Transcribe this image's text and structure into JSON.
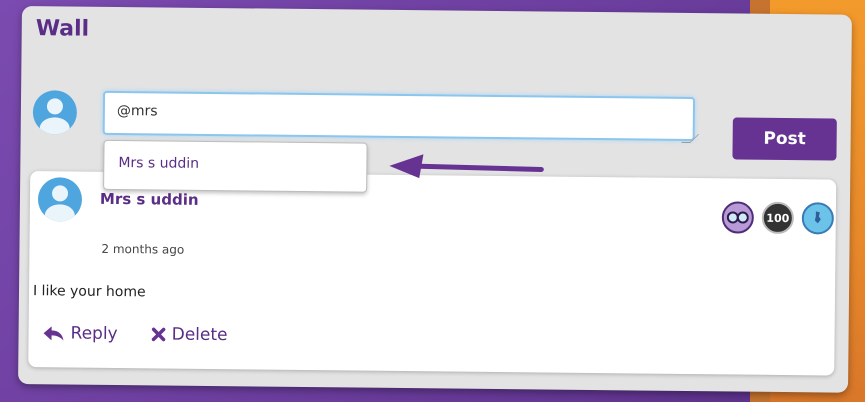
{
  "wall": {
    "title": "Wall"
  },
  "post": {
    "input_value": "@mrs",
    "post_label": "Post"
  },
  "mention_suggestions": [
    {
      "label": "Mrs s uddin"
    }
  ],
  "comment": {
    "author": "Mrs s uddin",
    "time": "2 months ago",
    "text": "I like your home",
    "badges": [
      "glasses-badge-icon",
      "100-badge-icon",
      "globe-badge-icon"
    ],
    "badge_100_label": "100",
    "actions": {
      "reply_label": "Reply",
      "delete_label": "Delete"
    }
  },
  "colors": {
    "brand_purple": "#663392",
    "accent_blue": "#4fa6de",
    "background_orange": "#f39a2c"
  }
}
